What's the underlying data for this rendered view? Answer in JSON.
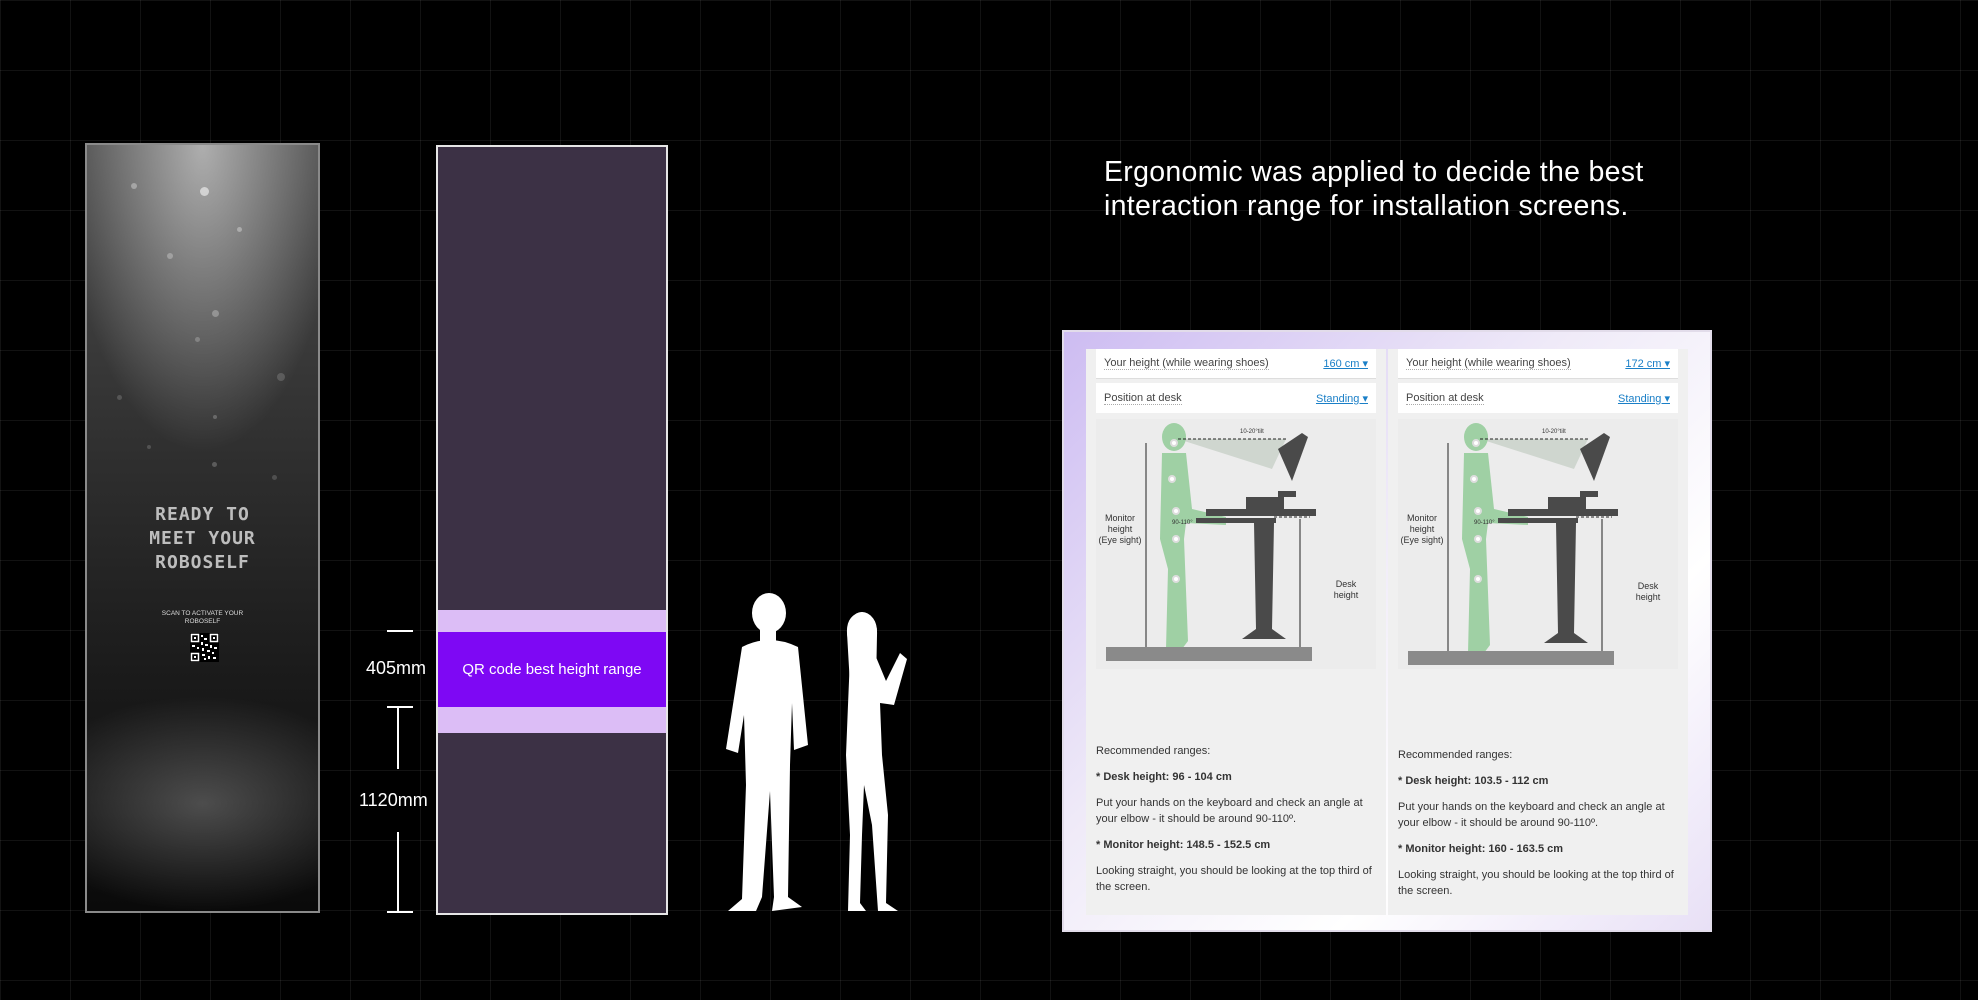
{
  "kiosk": {
    "headline": [
      "READY TO",
      "MEET YOUR",
      "ROBOSELF"
    ],
    "scan_text": [
      "SCAN TO ACTIVATE YOUR",
      "ROBOSELF"
    ]
  },
  "panel": {
    "band_label": "QR code best height range",
    "dim_top": "405mm",
    "dim_bottom": "1120mm"
  },
  "heading": [
    "Ergonomic was applied to decide the best",
    "interaction range for installation screens."
  ],
  "calculators": [
    {
      "height_label": "Your height (while wearing shoes)",
      "height_value": "160 cm ▾",
      "position_label": "Position at desk",
      "position_value": "Standing ▾",
      "angle_label": "10-20°tilt",
      "monitor_label": [
        "Monitor",
        "height",
        "(Eye sight)"
      ],
      "elbow_label": "90-110°",
      "desk_label": [
        "Desk",
        "height"
      ],
      "recommended": "Recommended ranges:",
      "desk_height": "* Desk height: 96 - 104 cm",
      "elbow_text": "Put your hands on the keyboard and check an angle at your elbow - it should be around 90-110º.",
      "monitor_height": "* Monitor height: 148.5 - 152.5 cm",
      "look_text": "Looking straight, you should be looking at the top third of the screen."
    },
    {
      "height_label": "Your height (while wearing shoes)",
      "height_value": "172 cm ▾",
      "position_label": "Position at desk",
      "position_value": "Standing ▾",
      "angle_label": "10-20°tilt",
      "monitor_label": [
        "Monitor",
        "height",
        "(Eye sight)"
      ],
      "elbow_label": "90-110°",
      "desk_label": [
        "Desk",
        "height"
      ],
      "recommended": "Recommended ranges:",
      "desk_height": "* Desk height: 103.5 - 112 cm",
      "elbow_text": "Put your hands on the keyboard and check an angle at your elbow - it should be around 90-110º.",
      "monitor_height": "* Monitor height: 160 - 163.5 cm",
      "look_text": "Looking straight, you should be looking at the top third of the screen."
    }
  ],
  "colors": {
    "panel": "#3c3145",
    "band_light": "#dcbdf6",
    "band_dark": "#7e08f4",
    "figure_green": "#9fd0a4"
  }
}
